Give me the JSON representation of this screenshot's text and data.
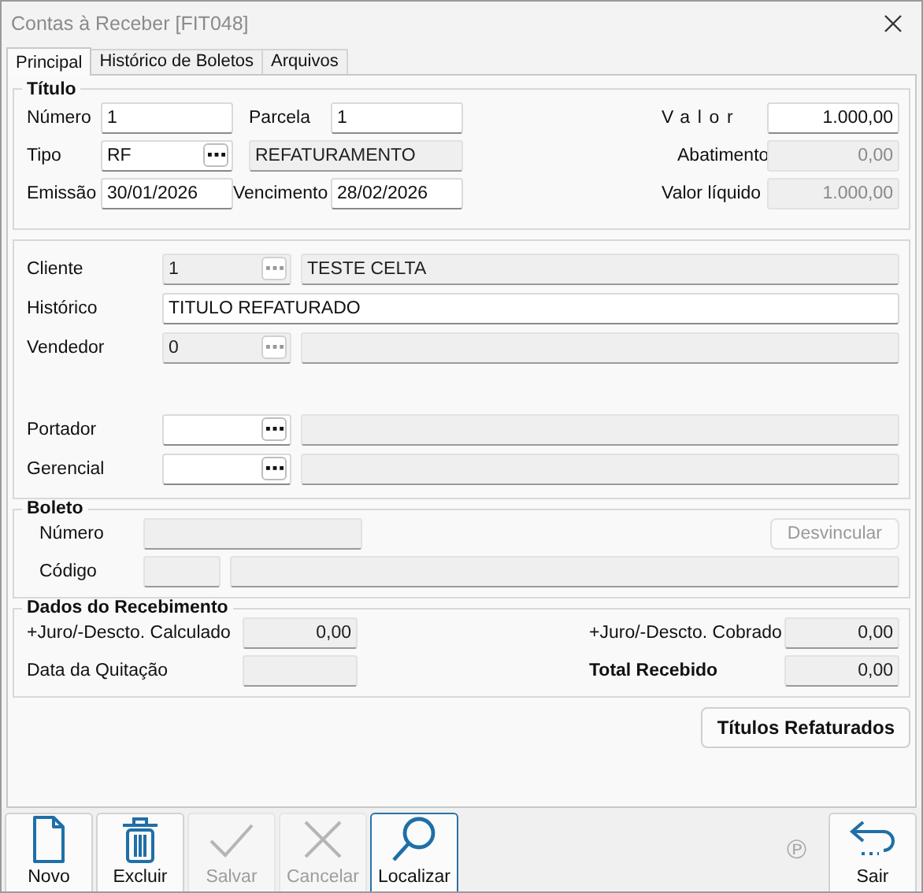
{
  "window": {
    "title": "Contas à Receber [FIT048]"
  },
  "tabs": [
    {
      "label": "Principal",
      "selected": true
    },
    {
      "label": "Histórico de Boletos",
      "selected": false
    },
    {
      "label": "Arquivos",
      "selected": false
    }
  ],
  "titulo": {
    "title": "Título",
    "numero": {
      "label": "Número",
      "value": "1",
      "kind": "input"
    },
    "parcela": {
      "label": "Parcela",
      "value": "1",
      "kind": "input"
    },
    "valor": {
      "label": "Valor",
      "value": "1.000,00",
      "kind": "input"
    },
    "tipo": {
      "label": "Tipo",
      "value": "RF",
      "kind": "input",
      "lookup": {
        "disabled": false
      },
      "description": "REFATURAMENTO"
    },
    "abatimento": {
      "label": "Abatimento",
      "value": "0,00",
      "kind": "disabled"
    },
    "emissao": {
      "label": "Emissão",
      "value": "30/01/2026",
      "kind": "input"
    },
    "vencimento": {
      "label": "Vencimento",
      "value": "28/02/2026",
      "kind": "input"
    },
    "valor_liquido": {
      "label": "Valor líquido",
      "value": "1.000,00",
      "kind": "disabled"
    }
  },
  "cliente_section": [
    {
      "label": "Cliente",
      "value": "1",
      "kind": "readonly",
      "lookup": {
        "disabled": true
      },
      "description": "TESTE CELTA"
    },
    {
      "label": "Histórico",
      "value": "TITULO REFATURADO",
      "kind": "input"
    },
    {
      "label": "Vendedor",
      "value": "0",
      "kind": "readonly",
      "lookup": {
        "disabled": true
      }
    },
    {
      "label": "Portador",
      "kind": "input",
      "lookup": {
        "disabled": false
      }
    },
    {
      "label": "Gerencial",
      "kind": "input",
      "lookup": {
        "disabled": false
      }
    }
  ],
  "boleto": {
    "title": "Boleto",
    "numero_label": "Número",
    "codigo_label": "Código",
    "unlink_button": {
      "label": "Desvincular",
      "disabled": true
    }
  },
  "recebimento": {
    "title": "Dados do Recebimento",
    "calculado": {
      "label": "+Juro/-Descto. Calculado",
      "value": "0,00"
    },
    "cobrado": {
      "label": "+Juro/-Descto. Cobrado",
      "value": "0,00"
    },
    "quitacao": {
      "label": "Data da Quitação"
    },
    "total": {
      "label": "Total Recebido",
      "value": "0,00"
    }
  },
  "refaturados_button": "Títulos Refaturados",
  "toolbar": [
    {
      "label": "Novo",
      "kind": "new",
      "disabled": false,
      "focused": false
    },
    {
      "label": "Excluir",
      "kind": "delete",
      "disabled": false,
      "focused": false
    },
    {
      "label": "Salvar",
      "kind": "save",
      "disabled": true,
      "focused": false
    },
    {
      "label": "Cancelar",
      "kind": "cancel",
      "disabled": true,
      "focused": false
    },
    {
      "label": "Localizar",
      "kind": "search",
      "disabled": false,
      "focused": true
    }
  ],
  "status_mark": "℗",
  "exit_button": "Sair"
}
